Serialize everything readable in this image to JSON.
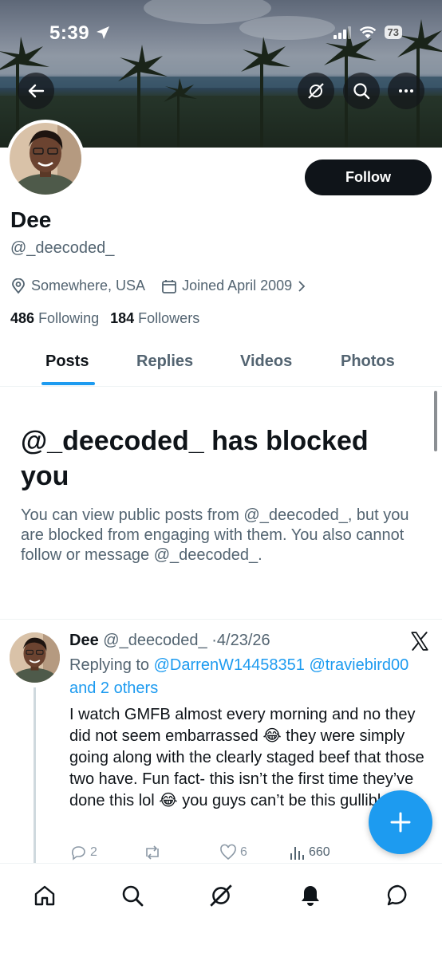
{
  "status_bar": {
    "time": "5:39",
    "battery": "73"
  },
  "profile": {
    "name": "Dee",
    "handle": "@_deecoded_",
    "location": "Somewhere, USA",
    "joined": "Joined April 2009",
    "following_count": "486",
    "following_label": "Following",
    "followers_count": "184",
    "followers_label": "Followers",
    "follow_button": "Follow"
  },
  "tabs": [
    {
      "label": "Posts",
      "active": true
    },
    {
      "label": "Replies"
    },
    {
      "label": "Videos"
    },
    {
      "label": "Photos"
    }
  ],
  "blocked": {
    "title": "@_deecoded_ has blocked you",
    "body": "You can view public posts from @_deecoded_, but you are blocked from engaging with them. You also cannot follow or message @_deecoded_."
  },
  "post": {
    "author_name": "Dee",
    "author_handle": "@_deecoded_",
    "separator": "·",
    "date": "4/23/26",
    "replying_to_label": "Replying to",
    "reply_handle_1": "@DarrenW14458351",
    "reply_handle_2": "@traviebird00",
    "reply_others": "and 2 others",
    "text_part1": "I watch GMFB almost every morning and no they did not seem embarrassed ",
    "emoji1": "😂",
    "text_part2": " they were simply  going along with the clearly staged beef that those two have. Fun fact-  this isn’t the first time they’ve done this lol ",
    "emoji2": "😂",
    "text_part3": " you guys can’t be this gullible",
    "replies": "2",
    "likes": "6",
    "views": "660"
  },
  "colors": {
    "accent": "#1d9bf0",
    "text": "#0f1419",
    "muted": "#536471"
  },
  "icons": {
    "back": "arrow-left-icon",
    "grok": "grok-icon",
    "search": "search-icon",
    "more": "more-icon",
    "location": "location-pin-icon",
    "calendar": "calendar-icon",
    "fab": "compose-plus-icon",
    "nav": [
      "home-icon",
      "search-icon",
      "grok-icon",
      "notifications-bell-icon",
      "messages-icon"
    ]
  }
}
